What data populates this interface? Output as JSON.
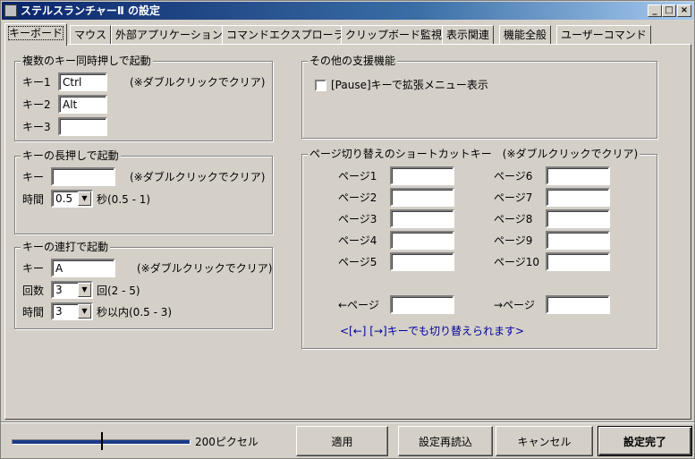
{
  "window": {
    "title": "ステルスランチャーⅡ の設定",
    "minimize_icon": "_",
    "maximize_icon": "□",
    "close_icon": "×"
  },
  "tabs": [
    {
      "label": "キーボード",
      "active": true
    },
    {
      "label": "マウス"
    },
    {
      "label": "外部アプリケーション"
    },
    {
      "label": "コマンドエクスプローラ"
    },
    {
      "label": "クリップボード監視"
    },
    {
      "label": "表示関連"
    },
    {
      "label": "機能全般"
    },
    {
      "label": "ユーザーコマンド"
    }
  ],
  "multi_key": {
    "title": "複数のキー同時押しで起動",
    "key1_label": "キー1",
    "key1_value": "Ctrl",
    "key2_label": "キー2",
    "key2_value": "Alt",
    "key3_label": "キー3",
    "key3_value": "",
    "note": "(※ダブルクリックでクリア)"
  },
  "long_press": {
    "title": "キーの長押しで起動",
    "key_label": "キー",
    "key_value": "",
    "note": "(※ダブルクリックでクリア)",
    "time_label": "時間",
    "time_value": "0.5",
    "time_unit": "秒(0.5 - 1)"
  },
  "rapid_press": {
    "title": "キーの連打で起動",
    "key_label": "キー",
    "key_value": "A",
    "note": "(※ダブルクリックでクリア)",
    "count_label": "回数",
    "count_value": "3",
    "count_unit": "回(2 - 5)",
    "time_label": "時間",
    "time_value": "3",
    "time_unit": "秒以内(0.5 - 3)"
  },
  "other": {
    "title": "その他の支援機能",
    "pause_menu_label": "[Pause]キーで拡張メニュー表示",
    "pause_menu_checked": false
  },
  "page_shortcuts": {
    "title": "ページ切り替えのショートカットキー　(※ダブルクリックでクリア)",
    "pages_left": [
      "ページ1",
      "ページ2",
      "ページ3",
      "ページ4",
      "ページ5"
    ],
    "pages_right": [
      "ページ6",
      "ページ7",
      "ページ8",
      "ページ9",
      "ページ10"
    ],
    "prev_label": "←ページ",
    "next_label": "→ページ",
    "hint": "<[←] [→]キーでも切り替えられます>"
  },
  "footer": {
    "slider_value_label": "200ピクセル",
    "slider_fraction": 0.5,
    "apply_label": "適用",
    "reload_label": "設定再読込",
    "cancel_label": "キャンセル",
    "ok_label": "設定完了"
  },
  "colors": {
    "title_bar": "#0a246a",
    "face": "#d4d0c8",
    "slider_track": "#1a3a8a",
    "hint_text": "#0000a0"
  }
}
